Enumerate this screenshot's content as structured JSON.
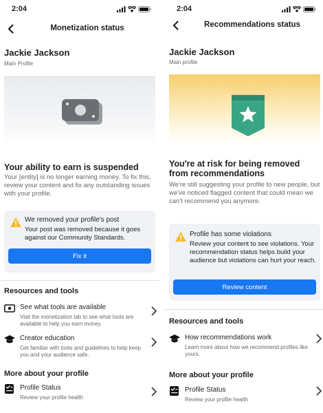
{
  "status_bar": {
    "time": "2:04"
  },
  "left": {
    "nav_title": "Monetization status",
    "profile": {
      "name": "Jackie Jackson",
      "subtitle": "Main Profile"
    },
    "heading": "Your ability to earn is suspended",
    "body": "Your [entity] is no longer earning money. To fix this, review your content and fix any outstanding issues with your profile.",
    "card": {
      "title": "We removed your profile's post",
      "text": "Your post was removed because it goes against our Community Standards.",
      "button": "Fix it"
    },
    "resources_title": "Resources and tools",
    "rows": [
      {
        "title": "See what tools are available",
        "desc": "Visit the monetization tab to see what tools are available to help you earn money.",
        "icon": "money-icon"
      },
      {
        "title": "Creator education",
        "desc": "Get familiar with tools and guidelines to help keep you and your audience safe.",
        "icon": "graduation-cap-icon"
      }
    ],
    "more_title": "More about your profile",
    "profile_row": {
      "title": "Profile Status",
      "desc": "Review your profile health",
      "icon": "checklist-icon"
    }
  },
  "right": {
    "nav_title": "Recommendations status",
    "profile": {
      "name": "Jackie Jackson",
      "subtitle": "Main profile"
    },
    "heading": "You're at risk for being removed from recommendations",
    "body": "We're still suggesting your profile to new people, but we've noticed flagged content that could mean we can't recommend you anymore.",
    "card": {
      "title": "Profile has some violations",
      "text": "Review your content to see violations. Your recommendation status helps build your audience but violations can hurt your reach.",
      "button": "Review content"
    },
    "resources_title": "Resources and tools",
    "rows": [
      {
        "title": "How recommendations work",
        "desc": "Learn more about how we recommend profiles like yours.",
        "icon": "graduation-cap-icon"
      }
    ],
    "more_title": "More about your profile",
    "profile_row": {
      "title": "Profile Status",
      "desc": "Review your profile health",
      "icon": "checklist-icon"
    }
  },
  "colors": {
    "primary": "#1877f2",
    "warning": "#f7b928",
    "badge": "#3aa585",
    "card_bg": "#f0f2f5"
  }
}
